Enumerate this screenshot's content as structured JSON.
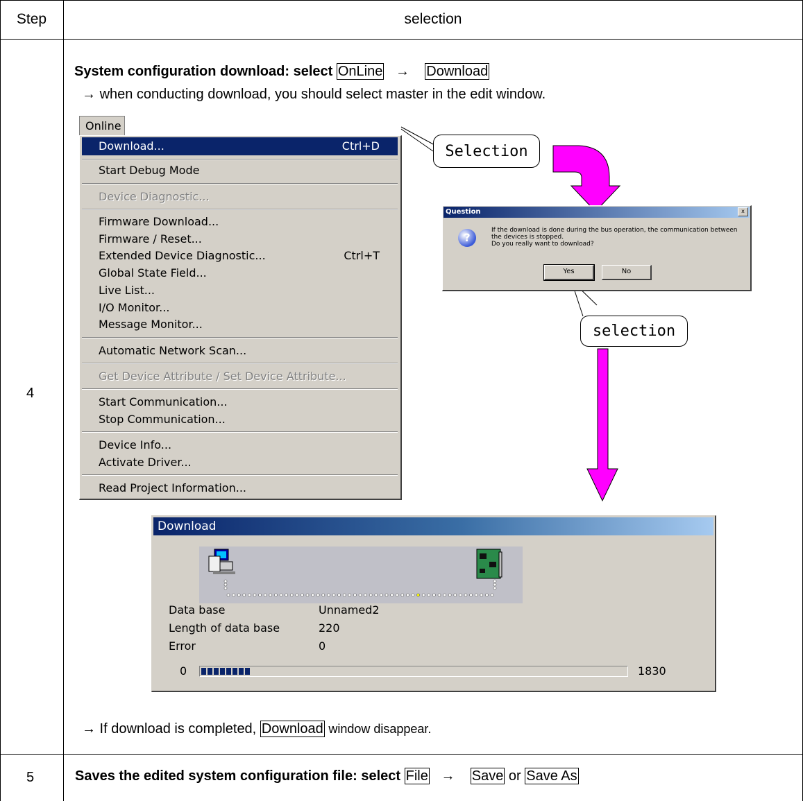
{
  "header": {
    "step_label": "Step",
    "selection_label": "selection"
  },
  "step4": {
    "number": "4",
    "title_bold": "System configuration download: select",
    "btn_online": "OnLine",
    "arrow1": "→",
    "btn_download": "Download",
    "note_prefix": "→",
    "note": "when conducting download, you should select master in the edit window.",
    "menu": {
      "title": "Online",
      "items": [
        {
          "label": "Download...",
          "shortcut": "Ctrl+D",
          "state": "highlighted"
        },
        {
          "label": "Start Debug Mode",
          "shortcut": "",
          "state": "normal"
        },
        {
          "label": "Device Diagnostic...",
          "shortcut": "",
          "state": "disabled"
        },
        {
          "label": "Firmware Download...",
          "shortcut": "",
          "state": "normal"
        },
        {
          "label": "Firmware / Reset...",
          "shortcut": "",
          "state": "normal"
        },
        {
          "label": "Extended Device Diagnostic...",
          "shortcut": "Ctrl+T",
          "state": "normal"
        },
        {
          "label": "Global State Field...",
          "shortcut": "",
          "state": "normal"
        },
        {
          "label": "Live List...",
          "shortcut": "",
          "state": "normal"
        },
        {
          "label": "I/O Monitor...",
          "shortcut": "",
          "state": "normal"
        },
        {
          "label": "Message Monitor...",
          "shortcut": "",
          "state": "normal"
        },
        {
          "label": "Automatic Network Scan...",
          "shortcut": "",
          "state": "normal"
        },
        {
          "label": "Get Device Attribute / Set Device Attribute...",
          "shortcut": "",
          "state": "disabled"
        },
        {
          "label": "Start Communication...",
          "shortcut": "",
          "state": "normal"
        },
        {
          "label": "Stop Communication...",
          "shortcut": "",
          "state": "normal"
        },
        {
          "label": "Device Info...",
          "shortcut": "",
          "state": "normal"
        },
        {
          "label": "Activate Driver...",
          "shortcut": "",
          "state": "normal"
        },
        {
          "label": "Read Project Information...",
          "shortcut": "",
          "state": "normal"
        }
      ]
    },
    "callout_selection1": "Selection",
    "callout_selection2": "selection",
    "question_dialog": {
      "title": "Question",
      "close": "x",
      "icon": "?",
      "message_line1": "If the download is done during the bus operation, the communication between",
      "message_line2": "the devices is stopped.",
      "message_line3": "Do you really want to download?",
      "yes": "Yes",
      "no": "No"
    },
    "download_window": {
      "title": "Download",
      "labels": {
        "database": "Data base",
        "length": "Length of data base",
        "error": "Error"
      },
      "values": {
        "database": "Unnamed2",
        "length": "220",
        "error": "0"
      },
      "progress_min": "0",
      "progress_max": "1830",
      "progress_fraction": 0.12
    },
    "footer_prefix": "→ If download is completed,",
    "footer_boxed": "Download",
    "footer_suffix": "window disappear."
  },
  "step5": {
    "number": "5",
    "text_bold": "Saves the edited system configuration file: select",
    "btn_file": "File",
    "arrow": "→",
    "btn_save": "Save",
    "or": "or",
    "btn_save_as": "Save As"
  },
  "colors": {
    "menu_highlight": "#0a246a",
    "arrow_magenta": "#ff00ff",
    "window_gray": "#d4d0c8"
  }
}
